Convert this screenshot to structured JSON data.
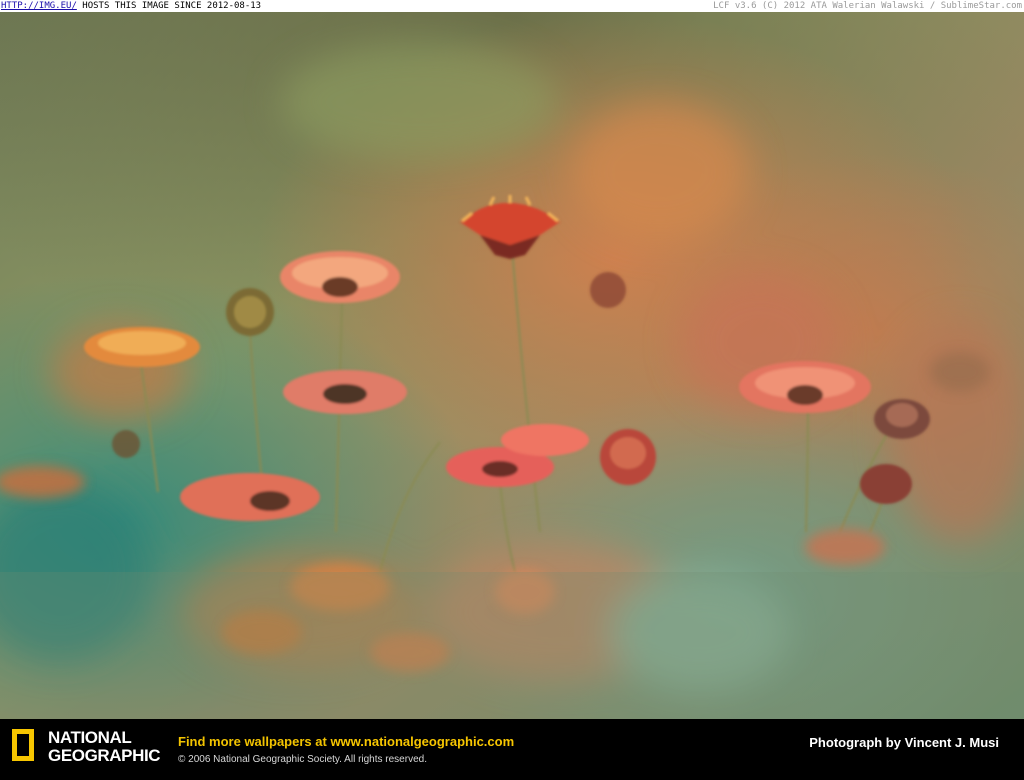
{
  "topbar": {
    "link": "HTTP://IMG.EU/",
    "hosts_text": "HOSTS THIS IMAGE SINCE 2012-08-13",
    "right_text": "LCF v3.6 (C) 2012 ATA Walerian Walawski / SublimeStar.com"
  },
  "footer": {
    "logo_line1": "NATIONAL",
    "logo_line2": "GEOGRAPHIC",
    "promo_prefix": "Find more wallpapers at ",
    "promo_url": "www.nationalgeographic.com",
    "copyright": "© 2006 National Geographic Society. All rights reserved.",
    "credit": "Photograph by Vincent J. Musi"
  },
  "colors": {
    "brand_yellow": "#f7c600",
    "bar_bg": "#000000"
  }
}
